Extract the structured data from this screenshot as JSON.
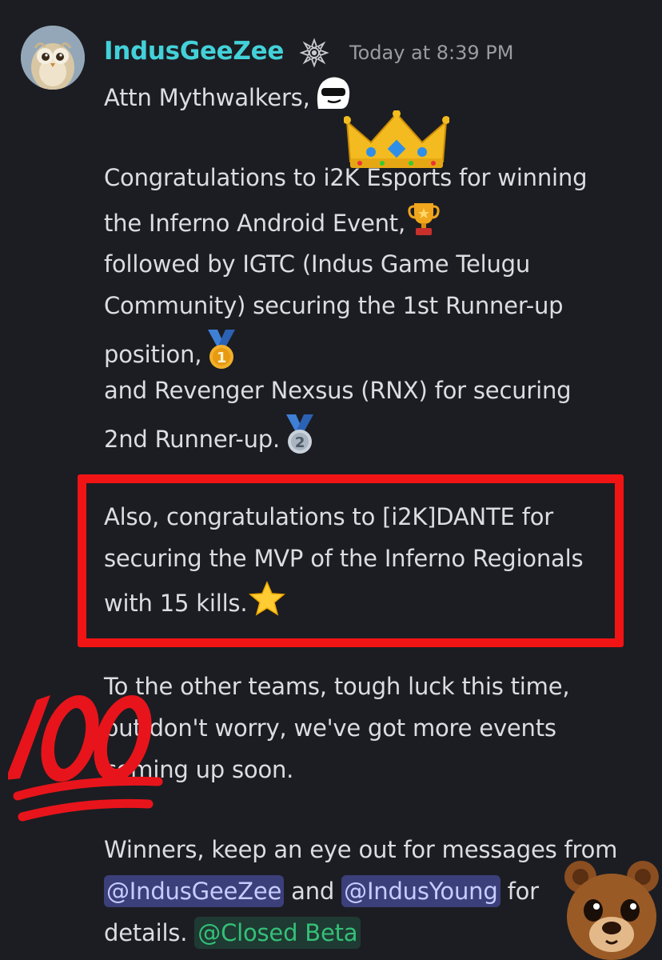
{
  "message": {
    "author": {
      "username": "IndusGeeZee",
      "avatar_icon": "owl-avatar",
      "badge_icon": "mandala-badge-icon",
      "username_color": "#43d1d9"
    },
    "timestamp": "Today at 8:39 PM",
    "lines": {
      "l1": "Attn Mythwalkers,",
      "l2": "Congratulations to i2K Esports for winning",
      "l3": "the Inferno Android Event,",
      "l4": "followed by IGTC (Indus Game Telugu",
      "l5": "Community) securing the 1st Runner-up",
      "l6": "position,",
      "l7": "and Revenger Nexsus (RNX) for securing",
      "l8": "2nd Runner-up.",
      "l9": "Also, congratulations to [i2K]DANTE for",
      "l10": "securing the MVP of the Inferno Regionals",
      "l11": "with 15 kills.",
      "l12": "To the other teams, tough luck this time,",
      "l13": "but don't worry, we've got more events",
      "l14": "coming up soon.",
      "l15": "Winners, keep an eye out for messages from",
      "l16_and": " and ",
      "l16_for": " for",
      "l17": "details. "
    },
    "mentions": {
      "user1": "@IndusGeeZee",
      "user2": "@IndusYoung",
      "role": "@Closed Beta"
    },
    "emojis": [
      "cool-ghost-sticker-icon",
      "crown-icon",
      "trophy-icon",
      "first-place-medal-icon",
      "second-place-medal-icon",
      "star-icon",
      "hundred-points-icon",
      "bear-face-icon"
    ],
    "colors": {
      "background": "#1c1d22",
      "text": "#dcdde0",
      "timestamp": "#9a9ca4",
      "mention_bg": "#3b3f7a",
      "mention_text": "#c7ccff",
      "role_bg": "#1f3a33",
      "role_text": "#34c077",
      "highlight_box": "#f01414"
    }
  }
}
